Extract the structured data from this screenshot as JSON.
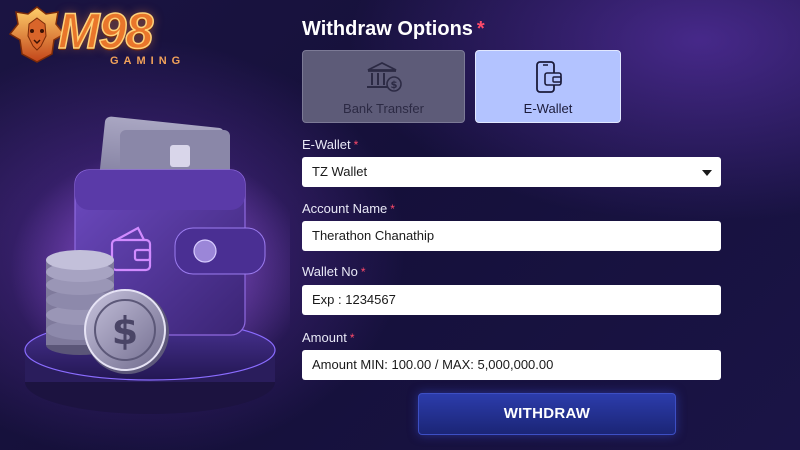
{
  "brand": {
    "logo_word": "M98",
    "logo_sub": "GAMING"
  },
  "form": {
    "title": "Withdraw Options",
    "required_mark": "*",
    "options": [
      {
        "label": "Bank Transfer",
        "icon": "bank-icon",
        "selected": false
      },
      {
        "label": "E-Wallet",
        "icon": "ewallet-icon",
        "selected": true
      }
    ],
    "ewallet": {
      "label": "E-Wallet",
      "value": "TZ Wallet"
    },
    "account_name": {
      "label": "Account Name",
      "value": "Therathon Chanathip"
    },
    "wallet_no": {
      "label": "Wallet No",
      "placeholder": "Exp : 1234567"
    },
    "amount": {
      "label": "Amount",
      "placeholder": "Amount MIN: 100.00 / MAX: 5,000,000.00"
    },
    "submit_label": "WITHDRAW"
  },
  "colors": {
    "accent_button": "#1f2a84",
    "selected_option": "#b3c3ff",
    "unselected_option": "#5d5b78",
    "required": "#ff4a6a"
  }
}
